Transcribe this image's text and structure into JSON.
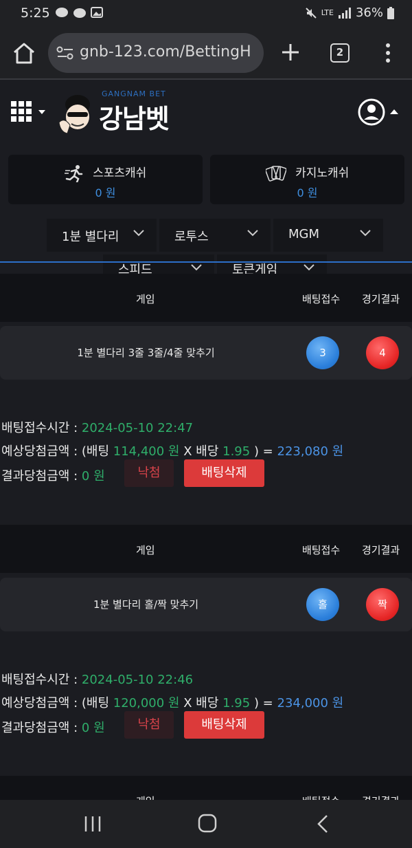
{
  "status_bar": {
    "time": "5:25",
    "battery": "36%",
    "network": "LTE"
  },
  "browser": {
    "url": "gnb-123.com/BettingH",
    "tab_count": "2"
  },
  "header": {
    "logo_sub": "GANGNAM BET",
    "logo_main": "강남벳"
  },
  "cash": {
    "sports": {
      "label": "스포츠캐쉬",
      "value": "0 원",
      "icon": "running-icon"
    },
    "casino": {
      "label": "카지노캐쉬",
      "value": "0 원",
      "icon": "cards-icon"
    }
  },
  "filters": {
    "items": [
      "1분 별다리",
      "로투스",
      "MGM",
      "스피드",
      "토큰게임"
    ]
  },
  "table_headers": {
    "game": "게임",
    "accept": "배팅접수",
    "result": "경기결과"
  },
  "bets": [
    {
      "game_title": "1분 별다리 3줄 3줄/4줄 맞추기",
      "accept_ball": "3",
      "result_ball": "4",
      "time_label": "배팅접수시간 :",
      "time_value": "2024-05-10 22:47",
      "expected_label": "예상당첨금액 : (배팅",
      "bet_amount": "114,400 원",
      "x_odds_label": "X 배당",
      "odds": "1.95",
      "eq_label": ") =",
      "expected_amount": "223,080 원",
      "result_label": "결과당첨금액 :",
      "result_amount": "0 원",
      "status": "낙첨",
      "delete_label": "배팅삭제"
    },
    {
      "game_title": "1분 별다리 홀/짝 맞추기",
      "accept_ball": "홀",
      "result_ball": "짝",
      "time_label": "배팅접수시간 :",
      "time_value": "2024-05-10 22:46",
      "expected_label": "예상당첨금액 : (배팅",
      "bet_amount": "120,000 원",
      "x_odds_label": "X 배당",
      "odds": "1.95",
      "eq_label": ") =",
      "expected_amount": "234,000 원",
      "result_label": "결과당첨금액 :",
      "result_amount": "0 원",
      "status": "낙첨",
      "delete_label": "배팅삭제"
    }
  ],
  "colors": {
    "accent_blue": "#3f8fe0",
    "green": "#2fae6a",
    "red_button": "#dc3a3a"
  }
}
